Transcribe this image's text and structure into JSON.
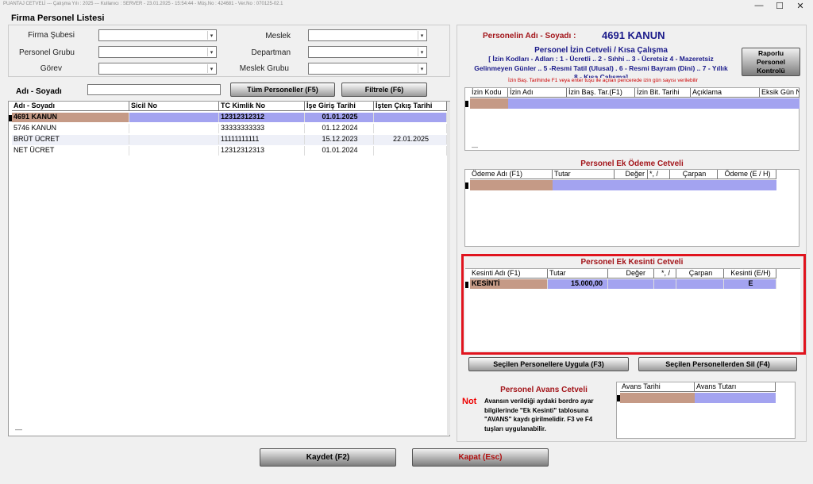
{
  "window": {
    "title": "PUANTAJ CETVELİ  ---  Çalışma Yılı : 2025  ---  Kullanıcı : SERVER - 23.01.2025 - 15:54:44 - Müş.No : 424681 - Ver.No : 070125-02.1",
    "min": "—",
    "max": "☐",
    "close": "✕"
  },
  "left": {
    "heading": "Firma Personel Listesi",
    "filters": {
      "firma_subesi": "Firma Şubesi",
      "personel_grubu": "Personel Grubu",
      "gorev": "Görev",
      "meslek": "Meslek",
      "departman": "Departman",
      "meslek_grubu": "Meslek Grubu"
    },
    "search_label": "Adı - Soyadı",
    "btn_all": "Tüm Personeller (F5)",
    "btn_filter": "Filtrele (F6)",
    "columns": [
      "Adı - Soyadı",
      "Sicil No",
      "TC Kimlik No",
      "İşe Giriş Tarihi",
      "İşten Çıkış Tarihi"
    ],
    "rows": [
      {
        "name": "4691 KANUN",
        "sicil": "",
        "tc": "12312312312",
        "giris": "01.01.2025",
        "cikis": ""
      },
      {
        "name": "5746 KANUN",
        "sicil": "",
        "tc": "33333333333",
        "giris": "01.12.2024",
        "cikis": ""
      },
      {
        "name": "BRÜT ÜCRET",
        "sicil": "",
        "tc": "11111111111",
        "giris": "15.12.2023",
        "cikis": "22.01.2025"
      },
      {
        "name": "NET ÜCRET",
        "sicil": "",
        "tc": "12312312313",
        "giris": "01.01.2024",
        "cikis": ""
      }
    ],
    "footer": "—"
  },
  "right": {
    "person_label": "Personelin Adı - Soyadı :",
    "person_name": "4691 KANUN",
    "izin": {
      "title": "Personel İzin Cetveli / Kısa Çalışma",
      "codes_line1": "[ İzin Kodları - Adları : 1 - Ücretli .. 2 - Sıhhi  .. 3 - Ücretsiz  4 - Mazeretsiz",
      "codes_line2": "Gelinmeyen Günler .. 5 -Resmi Tatil  (Ulusal) . 6 - Resmi Bayram (Dini) .. 7 - Yıllık",
      "codes_line3": "8 - Kısa Çalışma]",
      "note": "İzin Baş. Tarihinde F1 veya enter tuşu ile açılan pencerede izin gün sayısı verilebilir",
      "report_btn": "Raporlu Personel Kontrolü",
      "columns": [
        "İzin Kodu",
        "İzin Adı",
        "İzin Baş. Tar.(F1)",
        "İzin Bit. Tarihi",
        "Açıklama",
        "Eksik Gün N"
      ],
      "footer": "—"
    },
    "odeme": {
      "title": "Personel Ek Ödeme Cetveli",
      "columns": [
        "Ödeme Adı (F1)",
        "Tutar",
        "Değer",
        "*, /",
        "Çarpan",
        "Ödeme (E / H)"
      ]
    },
    "kesinti": {
      "title": "Personel Ek Kesinti Cetveli",
      "columns": [
        "Kesinti Adı (F1)",
        "Tutar",
        "Değer",
        "*, /",
        "Çarpan",
        "Kesinti (E/H)"
      ],
      "row": {
        "name": "KESİNTİ",
        "tutar": "15.000,00",
        "deger": "",
        "op": "",
        "carpan": "",
        "eh": "E"
      }
    },
    "btn_apply": "Seçilen Personellere Uygula (F3)",
    "btn_delete": "Seçilen Personellerden Sil (F4)",
    "avans": {
      "title": "Personel Avans Cetveli",
      "not_label": "Not",
      "note": "Avansın verildiği aydaki bordro ayar bilgilerinde \"Ek Kesinti\" tablosuna \"AVANS\" kaydı girilmelidir. F3 ve F4 tuşları uygulanabilir.",
      "columns": [
        "Avans Tarihi",
        "Avans Tutarı"
      ]
    }
  },
  "bottom": {
    "save": "Kaydet (F2)",
    "close": "Kapat (Esc)"
  },
  "colors": {
    "highlight_red": "#e0141e",
    "tan": "#c59a86",
    "lavender": "#a3a3f0",
    "title_red": "#a3151a",
    "navy": "#1a1a8a"
  }
}
